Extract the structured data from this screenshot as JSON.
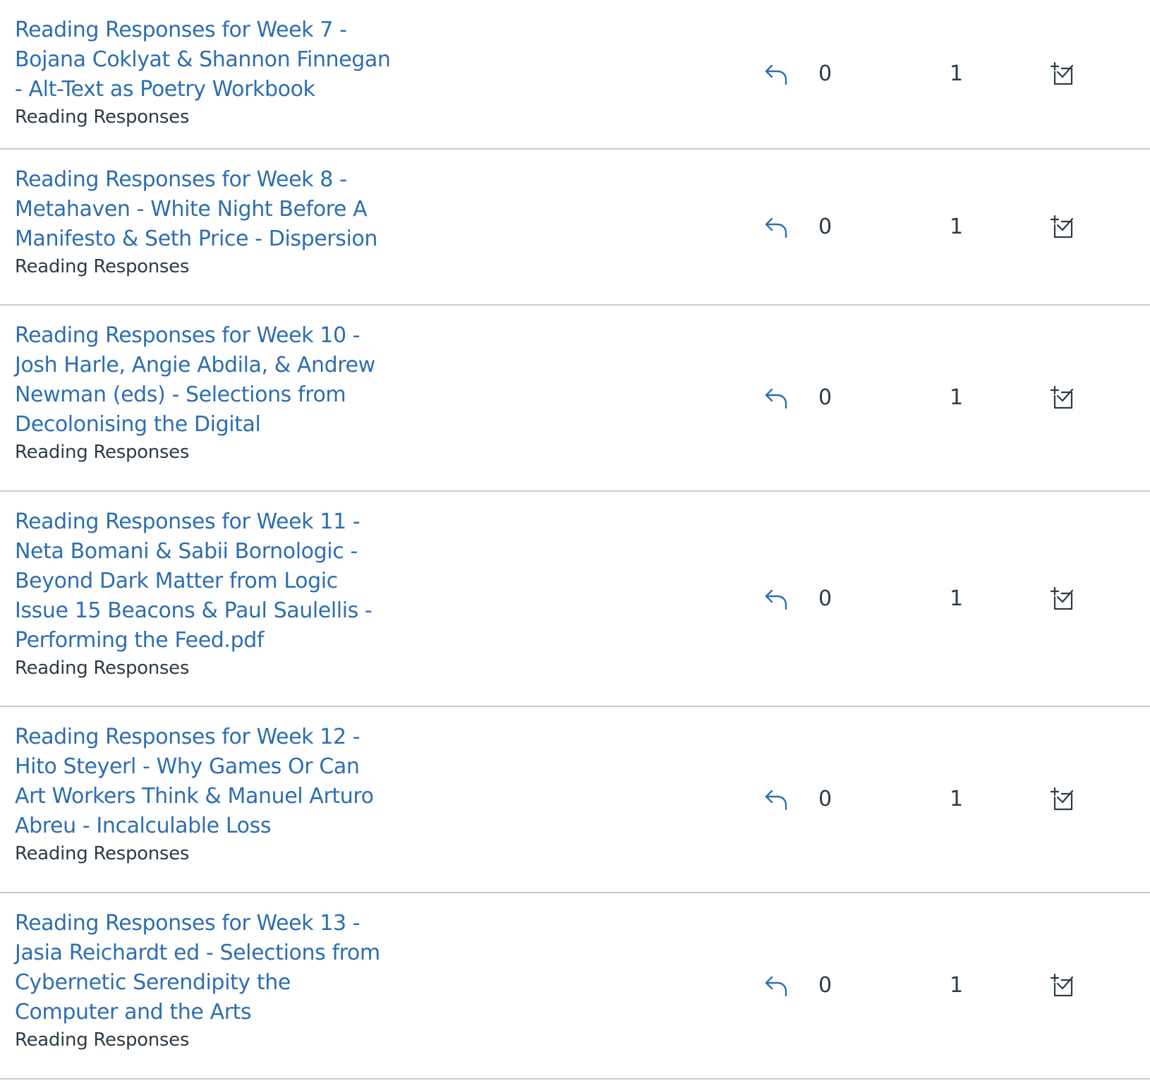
{
  "colors": {
    "link": "#2d6eb0",
    "text": "#2d3b45",
    "divider": "#c7cdd1",
    "icon": "#2d6eb0"
  },
  "icons": {
    "reply": "reply-arrow-icon",
    "todo": "add-to-do-icon"
  },
  "discussions": [
    {
      "title_lines": [
        "Reading Responses for Week 7 -",
        "Bojana Coklyat & Shannon Finnegan",
        "- Alt-Text as Poetry Workbook"
      ],
      "module": "Reading Responses",
      "replies": "0",
      "unread": "1"
    },
    {
      "title_lines": [
        "Reading Responses for Week 8 -",
        "Metahaven - White Night Before A",
        "Manifesto & Seth Price - Dispersion"
      ],
      "module": "Reading Responses",
      "replies": "0",
      "unread": "1"
    },
    {
      "title_lines": [
        "Reading Responses for Week 10 -",
        "Josh Harle, Angie Abdila, & Andrew",
        "Newman (eds) - Selections from",
        "Decolonising the Digital"
      ],
      "module": "Reading Responses",
      "replies": "0",
      "unread": "1"
    },
    {
      "title_lines": [
        "Reading Responses for Week 11 -",
        "Neta Bomani & Sabii Bornologic -",
        "Beyond Dark Matter from Logic",
        "Issue 15 Beacons & Paul Saulellis -",
        "Performing the Feed.pdf"
      ],
      "module": "Reading Responses",
      "replies": "0",
      "unread": "1"
    },
    {
      "title_lines": [
        "Reading Responses for Week 12 -",
        "Hito Steyerl - Why Games Or Can",
        "Art Workers Think & Manuel Arturo",
        "Abreu - Incalculable Loss"
      ],
      "module": "Reading Responses",
      "replies": "0",
      "unread": "1"
    },
    {
      "title_lines": [
        "Reading Responses for Week 13 -",
        "Jasia Reichardt ed - Selections from",
        "Cybernetic Serendipity the",
        "Computer and the Arts"
      ],
      "module": "Reading Responses",
      "replies": "0",
      "unread": "1"
    }
  ]
}
